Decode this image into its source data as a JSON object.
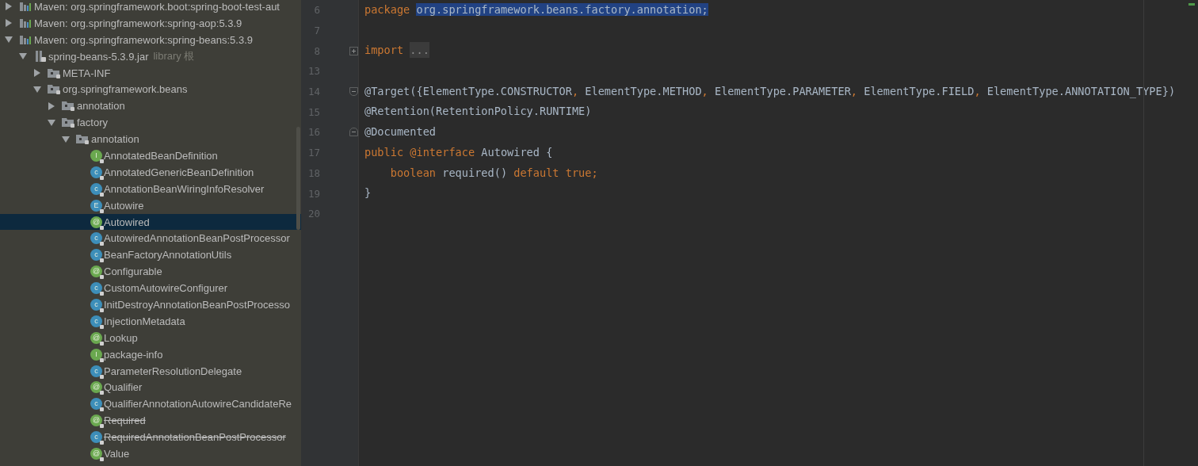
{
  "project_tree": {
    "items": [
      {
        "label": "Maven: org.springframework.boot:spring-boot-test-aut",
        "kind": "maven",
        "expanded": false,
        "selected": false
      },
      {
        "label": "Maven: org.springframework:spring-aop:5.3.9",
        "kind": "maven",
        "expanded": false,
        "selected": false
      },
      {
        "label": "Maven: org.springframework:spring-beans:5.3.9",
        "kind": "maven",
        "expanded": true,
        "selected": false,
        "children": [
          {
            "label": "spring-beans-5.3.9.jar",
            "suffix": "library 根",
            "kind": "jar",
            "expanded": true,
            "selected": false,
            "children": [
              {
                "label": "META-INF",
                "kind": "package",
                "expanded": false,
                "selected": false
              },
              {
                "label": "org.springframework.beans",
                "kind": "package",
                "expanded": true,
                "selected": false,
                "children": [
                  {
                    "label": "annotation",
                    "kind": "package",
                    "expanded": false,
                    "selected": false
                  },
                  {
                    "label": "factory",
                    "kind": "package",
                    "expanded": true,
                    "selected": false,
                    "children": [
                      {
                        "label": "annotation",
                        "kind": "package",
                        "expanded": true,
                        "selected": false,
                        "children": [
                          {
                            "label": "AnnotatedBeanDefinition",
                            "kind": "interface",
                            "letter": "I",
                            "selected": false,
                            "deprecated": false
                          },
                          {
                            "label": "AnnotatedGenericBeanDefinition",
                            "kind": "class",
                            "letter": "c",
                            "selected": false,
                            "deprecated": false
                          },
                          {
                            "label": "AnnotationBeanWiringInfoResolver",
                            "kind": "class",
                            "letter": "c",
                            "selected": false,
                            "deprecated": false
                          },
                          {
                            "label": "Autowire",
                            "kind": "enum",
                            "letter": "E",
                            "selected": false,
                            "deprecated": false
                          },
                          {
                            "label": "Autowired",
                            "kind": "annotation",
                            "letter": "@",
                            "selected": true,
                            "deprecated": false
                          },
                          {
                            "label": "AutowiredAnnotationBeanPostProcessor",
                            "kind": "class",
                            "letter": "c",
                            "selected": false,
                            "deprecated": false
                          },
                          {
                            "label": "BeanFactoryAnnotationUtils",
                            "kind": "class",
                            "letter": "c",
                            "selected": false,
                            "deprecated": false
                          },
                          {
                            "label": "Configurable",
                            "kind": "annotation",
                            "letter": "@",
                            "selected": false,
                            "deprecated": false
                          },
                          {
                            "label": "CustomAutowireConfigurer",
                            "kind": "class",
                            "letter": "c",
                            "selected": false,
                            "deprecated": false
                          },
                          {
                            "label": "InitDestroyAnnotationBeanPostProcesso",
                            "kind": "class",
                            "letter": "c",
                            "selected": false,
                            "deprecated": false
                          },
                          {
                            "label": "InjectionMetadata",
                            "kind": "class",
                            "letter": "c",
                            "selected": false,
                            "deprecated": false
                          },
                          {
                            "label": "Lookup",
                            "kind": "annotation",
                            "letter": "@",
                            "selected": false,
                            "deprecated": false
                          },
                          {
                            "label": "package-info",
                            "kind": "interface",
                            "letter": "I",
                            "selected": false,
                            "deprecated": false
                          },
                          {
                            "label": "ParameterResolutionDelegate",
                            "kind": "class",
                            "letter": "c",
                            "selected": false,
                            "deprecated": false
                          },
                          {
                            "label": "Qualifier",
                            "kind": "annotation",
                            "letter": "@",
                            "selected": false,
                            "deprecated": false
                          },
                          {
                            "label": "QualifierAnnotationAutowireCandidateRe",
                            "kind": "class",
                            "letter": "c",
                            "selected": false,
                            "deprecated": false
                          },
                          {
                            "label": "Required",
                            "kind": "annotation",
                            "letter": "@",
                            "selected": false,
                            "deprecated": true
                          },
                          {
                            "label": "RequiredAnnotationBeanPostProcessor",
                            "kind": "class",
                            "letter": "c",
                            "selected": false,
                            "deprecated": true
                          },
                          {
                            "label": "Value",
                            "kind": "annotation",
                            "letter": "@",
                            "selected": false,
                            "deprecated": false
                          }
                        ]
                      }
                    ]
                  }
                ]
              }
            ]
          }
        ]
      }
    ]
  },
  "editor": {
    "lines": [
      {
        "number": "6",
        "tokens": [
          {
            "text": "package ",
            "kind": "keyword"
          },
          {
            "text": "org.springframework.beans.factory.annotation;",
            "kind": "selected"
          }
        ]
      },
      {
        "number": "7"
      },
      {
        "number": "8",
        "fold_start": true,
        "folded": true,
        "tokens": [
          {
            "text": "import ",
            "kind": "keyword"
          },
          {
            "text": "...",
            "kind": "folded"
          }
        ]
      },
      {
        "number": "13"
      },
      {
        "number": "14",
        "fold_start": true,
        "folded": false,
        "tokens": [
          {
            "text": "@Target({ElementType.CONSTRUCTOR",
            "kind": "plain"
          },
          {
            "text": ", ",
            "kind": "keyword"
          },
          {
            "text": "ElementType.METHOD",
            "kind": "plain"
          },
          {
            "text": ", ",
            "kind": "keyword"
          },
          {
            "text": "ElementType.PARAMETER",
            "kind": "plain"
          },
          {
            "text": ", ",
            "kind": "keyword"
          },
          {
            "text": "ElementType.FIELD",
            "kind": "plain"
          },
          {
            "text": ", ",
            "kind": "keyword"
          },
          {
            "text": "ElementType.ANNOTATION_TYPE})",
            "kind": "plain"
          }
        ]
      },
      {
        "number": "15",
        "tokens": [
          {
            "text": "@Retention(RetentionPolicy.RUNTIME)",
            "kind": "plain"
          }
        ]
      },
      {
        "number": "16",
        "fold_end": true,
        "tokens": [
          {
            "text": "@Documented",
            "kind": "plain"
          }
        ]
      },
      {
        "number": "17",
        "tokens": [
          {
            "text": "public @interface ",
            "kind": "keyword"
          },
          {
            "text": "Autowired {",
            "kind": "plain"
          }
        ]
      },
      {
        "number": "18",
        "tokens": [
          {
            "text": "    boolean ",
            "kind": "keyword"
          },
          {
            "text": "required() ",
            "kind": "plain"
          },
          {
            "text": "default true;",
            "kind": "keyword"
          }
        ]
      },
      {
        "number": "19",
        "tokens": [
          {
            "text": "}",
            "kind": "plain"
          }
        ]
      },
      {
        "number": "20"
      }
    ]
  }
}
